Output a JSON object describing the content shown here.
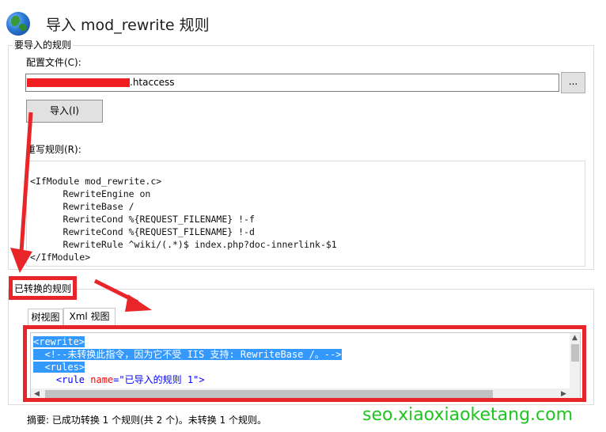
{
  "window": {
    "title": "导入 mod_rewrite 规则"
  },
  "import_group": {
    "legend": "要导入的规则",
    "config_file_label": "配置文件(C):",
    "config_file_value": ".htaccess",
    "browse_label": "...",
    "import_button": "导入(I)",
    "rewrite_rules_label": "重写规则(R):",
    "rewrite_rules_text": "<IfModule mod_rewrite.c>\n      RewriteEngine on\n      RewriteBase /\n      RewriteCond %{REQUEST_FILENAME} !-f\n      RewriteCond %{REQUEST_FILENAME} !-d\n      RewriteRule ^wiki/(.*)$ index.php?doc-innerlink-$1\n</IfModule>"
  },
  "converted_group": {
    "legend": "已转换的规则",
    "tabs": [
      {
        "label": "树视图",
        "active": false
      },
      {
        "label": "Xml 视图",
        "active": true
      }
    ],
    "xml": {
      "line1": "<rewrite>",
      "line2": "<!--未转换此指令，因为它不受 IIS 支持: RewriteBase /。-->",
      "line3": "<rules>",
      "line4_tag_open": "<rule",
      "line4_attr": "name",
      "line4_eq": "=",
      "line4_val": "\"已导入的规则 1\"",
      "line4_tag_close": ">"
    }
  },
  "summary": "摘要: 已成功转换 1 个规则(共 2 个)。未转换 1 个规则。",
  "watermark": "seo.xiaoxiaoketang.com",
  "colors": {
    "highlight": "#e8262a",
    "selection": "#3399ff",
    "watermark": "#1dc51d"
  }
}
